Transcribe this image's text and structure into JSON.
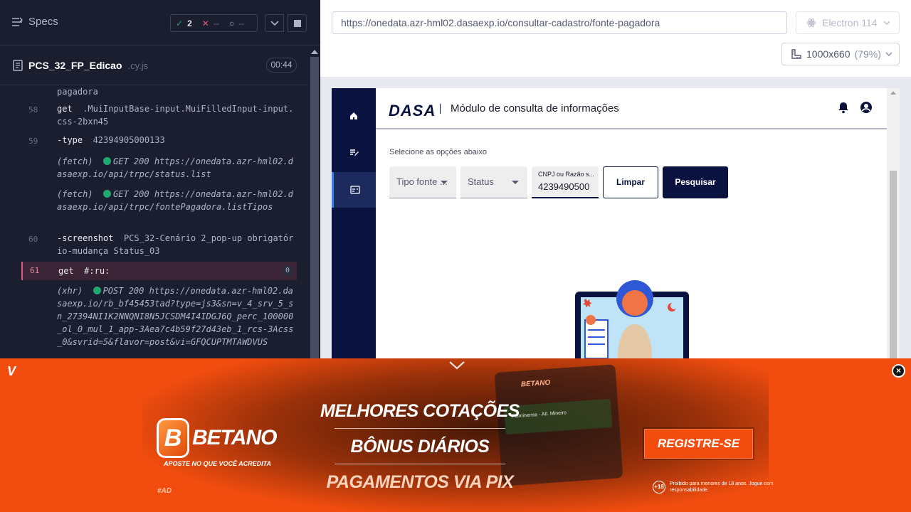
{
  "left_panel": {
    "specs_title": "Specs",
    "stats": {
      "passed": "2",
      "failed": "--",
      "pending": "--"
    },
    "file": {
      "name": "PCS_32_FP_Edicao",
      "ext": ".cy.js",
      "time": "00:44"
    },
    "commands": [
      {
        "line": "",
        "body": "pagadora"
      },
      {
        "line": "58",
        "keyword": "get",
        "body": ".MuiInputBase-input.MuiFilledInput-input.css-2bxn45"
      },
      {
        "line": "59",
        "keyword": "-type",
        "body": "42394905000133"
      },
      {
        "line": "",
        "prefix": "(fetch)",
        "body": "GET 200 https://onedata.azr-hml02.dasaexp.io/api/trpc/status.list"
      },
      {
        "line": "",
        "prefix": "(fetch)",
        "body": "GET 200 https://onedata.azr-hml02.dasaexp.io/api/trpc/fontePagadora.listTipos"
      },
      {
        "line": "60",
        "keyword": "-screenshot",
        "body": "PCS_32-Cenário 2_pop-up obrigatório-mudança Status_03"
      },
      {
        "line": "61",
        "keyword": "get",
        "body": "#:ru:",
        "badge": "0"
      },
      {
        "line": "",
        "prefix": "(xhr)",
        "body": "POST 200 https://onedata.azr-hml02.dasaexp.io/rb_bf45453tad?type=js3&sn=v_4_srv_5_sn_27394NI1K2NNQNI8N5JCSDM4I4IDGJ6Q_perc_100000_ol_0_mul_1_app-3Aea7c4b59f27d43eb_1_rcs-3Acss_0&svrid=5&flavor=post&vi=GFQCUPTMTAWDVUS"
      }
    ]
  },
  "preview": {
    "url": "https://onedata.azr-hml02.dasaexp.io/consultar-cadastro/fonte-pagadora",
    "browser": "Electron 114",
    "viewport": "1000x660",
    "zoom": "(79%)",
    "app": {
      "logo": "DASA",
      "title": "Módulo de consulta de informações",
      "hint": "Selecione as opções abaixo",
      "tipo_fonte": "Tipo fonte ...",
      "status": "Status",
      "cnpj_label": "CNPJ ou Razão s...",
      "cnpj_value": "4239490500",
      "btn_clear": "Limpar",
      "btn_search": "Pesquisar"
    }
  },
  "ad": {
    "corner_logo": "V",
    "brand": "BETANO",
    "brand_letter": "B",
    "tagline": "APOSTE NO QUE VOCÊ ACREDITA",
    "hashtag": "#AD",
    "lines": [
      "MELHORES COTAÇÕES",
      "BÔNUS DIÁRIOS",
      "PAGAMENTOS VIA PIX"
    ],
    "cta": "REGISTRE-SE",
    "age_badge": "+18",
    "age_text": "Proibido para menores de 18 anos. Jogue com responsabilidade.",
    "phone_brand": "BETANO",
    "phone_match": "Fluminense - Atl. Mineiro",
    "close": "×"
  }
}
